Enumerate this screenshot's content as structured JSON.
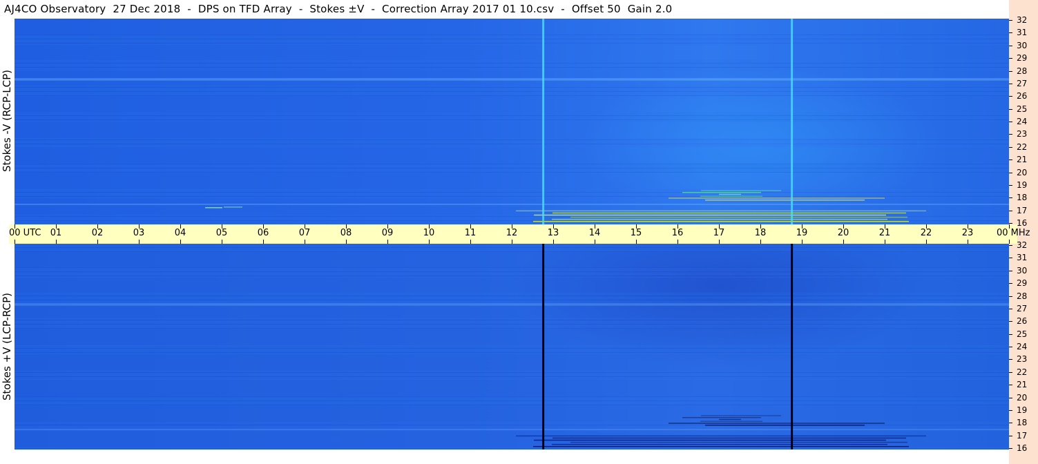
{
  "header": {
    "title": "AJ4CO Observatory  27 Dec 2018  -  DPS on TFD Array  -  Stokes ±V  -  Correction Array 2017 01 10.csv  -  Offset 50  Gain 2.0"
  },
  "chart_data": {
    "type": "heatmap",
    "title": "AJ4CO Observatory  27 Dec 2018  -  DPS on TFD Array  -  Stokes ±V  -  Correction Array 2017 01 10.csv  -  Offset 50  Gain 2.0",
    "x_axis": {
      "range_hours": [
        0,
        24
      ],
      "ticks": [
        "00 UTC",
        "01",
        "02",
        "03",
        "04",
        "05",
        "06",
        "07",
        "08",
        "09",
        "10",
        "11",
        "12",
        "13",
        "14",
        "15",
        "16",
        "17",
        "18",
        "19",
        "20",
        "21",
        "22",
        "23",
        "00 MHz"
      ],
      "end_label": "00 MHz"
    },
    "y_axis": {
      "range_mhz": [
        16,
        32
      ],
      "ticks": [
        "16",
        "17",
        "18",
        "19",
        "20",
        "21",
        "22",
        "23",
        "24",
        "25",
        "26",
        "27",
        "28",
        "29",
        "30",
        "31",
        "32"
      ]
    },
    "panels": [
      {
        "name": "Stokes -V (RCP-LCP)",
        "ylabel": "Stokes -V (RCP-LCP)",
        "marker_color": "#3fe0e8",
        "background_color": "#2566e6",
        "bursts": [
          {
            "start_hour": 12.1,
            "end_hour": 22.0,
            "low_mhz": 16.0,
            "high_mhz": 17.0,
            "color": "#c8e640"
          },
          {
            "start_hour": 15.5,
            "end_hour": 21.0,
            "low_mhz": 17.7,
            "high_mhz": 18.0,
            "color": "#f2e33a"
          },
          {
            "start_hour": 16.0,
            "end_hour": 18.5,
            "low_mhz": 18.0,
            "high_mhz": 18.6,
            "color": "#5fe0a0"
          },
          {
            "start_hour": 4.2,
            "end_hour": 5.5,
            "low_mhz": 17.2,
            "high_mhz": 17.3,
            "color": "#9ff0c0"
          }
        ]
      },
      {
        "name": "Stokes +V (LCP-RCP)",
        "ylabel": "Stokes +V (LCP-RCP)",
        "marker_color": "#000000",
        "background_color": "#2462e0",
        "bursts": [
          {
            "start_hour": 12.1,
            "end_hour": 22.0,
            "low_mhz": 16.0,
            "high_mhz": 17.0,
            "color": "#0a1a7a"
          },
          {
            "start_hour": 15.5,
            "end_hour": 21.0,
            "low_mhz": 17.7,
            "high_mhz": 18.0,
            "color": "#000033"
          },
          {
            "start_hour": 16.0,
            "end_hour": 18.5,
            "low_mhz": 18.0,
            "high_mhz": 18.6,
            "color": "#15308a"
          }
        ]
      }
    ],
    "vertical_markers_hours": [
      12.76,
      18.76
    ],
    "horizontal_lines_mhz": [
      27.3,
      27.4,
      17.5
    ],
    "grid": false
  }
}
